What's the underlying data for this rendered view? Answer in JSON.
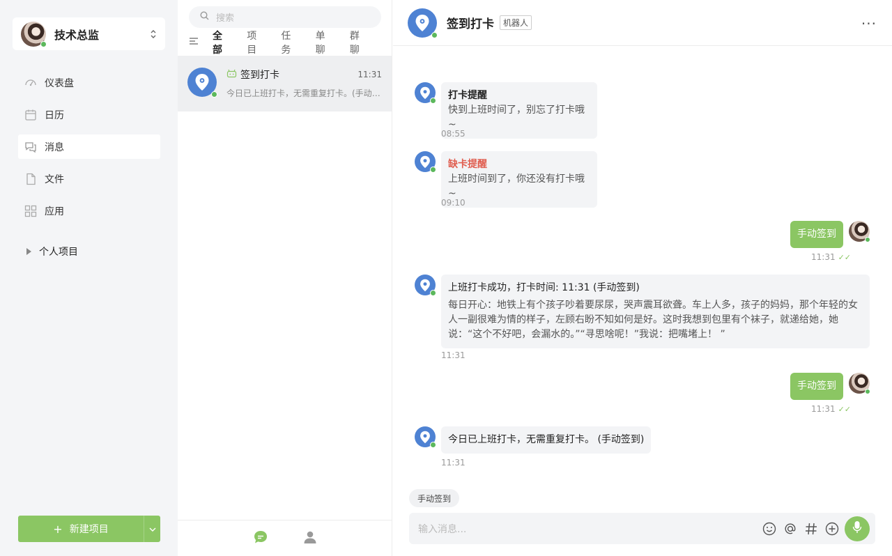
{
  "user": {
    "name": "技术总监"
  },
  "nav": [
    {
      "label": "仪表盘",
      "icon": "dashboard-icon"
    },
    {
      "label": "日历",
      "icon": "calendar-icon"
    },
    {
      "label": "消息",
      "icon": "message-icon",
      "active": true
    },
    {
      "label": "文件",
      "icon": "file-icon"
    },
    {
      "label": "应用",
      "icon": "apps-icon"
    }
  ],
  "projects": {
    "label": "个人项目"
  },
  "new_project": {
    "label": "新建项目"
  },
  "search": {
    "placeholder": "搜索"
  },
  "tabs": [
    "全部",
    "项目",
    "任务",
    "单聊",
    "群聊"
  ],
  "conversation": {
    "title": "签到打卡",
    "time": "11:31",
    "preview": "今日已上班打卡，无需重复打卡。(手动签到)"
  },
  "chat": {
    "title": "签到打卡",
    "badge": "机器人",
    "messages": [
      {
        "title": "打卡提醒",
        "body": "快到上班时间了，别忘了打卡哦~",
        "time": "08:55"
      },
      {
        "title": "缺卡提醒",
        "body": "上班时间到了，你还没有打卡哦~",
        "time": "09:10"
      },
      {
        "me": "手动签到",
        "time": "11:31"
      },
      {
        "title": "上班打卡成功，打卡时间: 11:31 (手动签到)",
        "body": "每日开心：地铁上有个孩子吵着要尿尿，哭声震耳欲聋。车上人多，孩子的妈妈，那个年轻的女人一副很难为情的样子，左顾右盼不知如何是好。这时我想到包里有个袜子，就递给她，她说：“这个不好吧，会漏水的。”“寻思啥呢！”我说：把嘴堵上！ ”",
        "time": "11:31"
      },
      {
        "me": "手动签到",
        "time": "11:31"
      },
      {
        "body": "今日已上班打卡，无需重复打卡。 (手动签到)",
        "time": "11:31"
      }
    ],
    "quick_reply": "手动签到",
    "input_placeholder": "输入消息..."
  },
  "colors": {
    "accent": "#8bc663",
    "bot": "#4e82d3",
    "alert": "#e05d4f",
    "online": "#5cb85c"
  }
}
